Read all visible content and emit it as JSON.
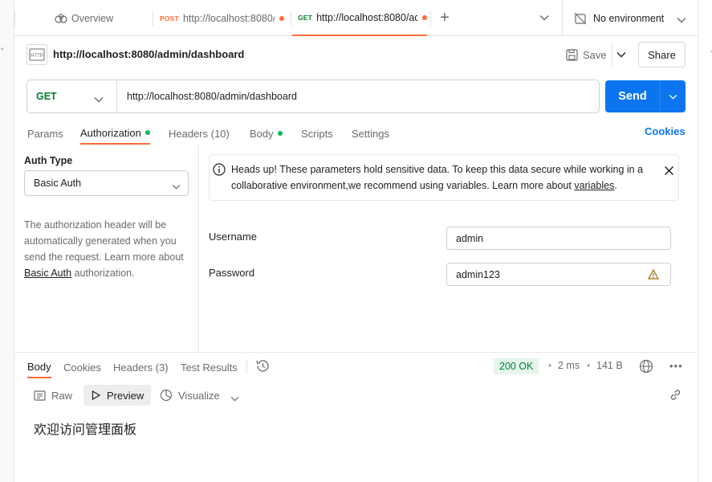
{
  "tabs": {
    "overview": "Overview",
    "tab1_method": "POST",
    "tab1_url": "http://localhost:8080/l",
    "tab2_method": "GET",
    "tab2_url": "http://localhost:8080/ad",
    "environment": "No environment"
  },
  "request": {
    "title": "http://localhost:8080/admin/dashboard",
    "save_label": "Save",
    "share_label": "Share",
    "method": "GET",
    "url": "http://localhost:8080/admin/dashboard",
    "send_label": "Send"
  },
  "request_tabs": {
    "params": "Params",
    "authorization": "Authorization",
    "headers": "Headers (10)",
    "body": "Body",
    "scripts": "Scripts",
    "settings": "Settings",
    "cookies": "Cookies"
  },
  "auth": {
    "type_label": "Auth Type",
    "type_value": "Basic Auth",
    "help_line1": "The authorization header will be",
    "help_line2": "automatically generated when you",
    "help_line3": "send the request. Learn more about",
    "help_link": "Basic Auth",
    "help_tail": " authorization.",
    "notice_line1": "Heads up! These parameters hold sensitive data. To keep this data secure while working in a",
    "notice_line2": "collaborative environment,we recommend using variables. Learn more about ",
    "notice_link": "variables",
    "notice_end": ".",
    "username_label": "Username",
    "username_value": "admin",
    "password_label": "Password",
    "password_value": "admin123"
  },
  "response": {
    "tabs": {
      "body": "Body",
      "cookies": "Cookies",
      "headers": "Headers (3)",
      "test_results": "Test Results"
    },
    "status": "200 OK",
    "time": "2 ms",
    "size": "141 B",
    "views": {
      "raw": "Raw",
      "preview": "Preview",
      "visualize": "Visualize"
    },
    "content": "欢迎访问管理面板"
  },
  "colors": {
    "accent": "#ff6c37",
    "send": "#0b75ef",
    "status_ok": "#007f31",
    "status_ok_bg": "#e5f6ec"
  }
}
